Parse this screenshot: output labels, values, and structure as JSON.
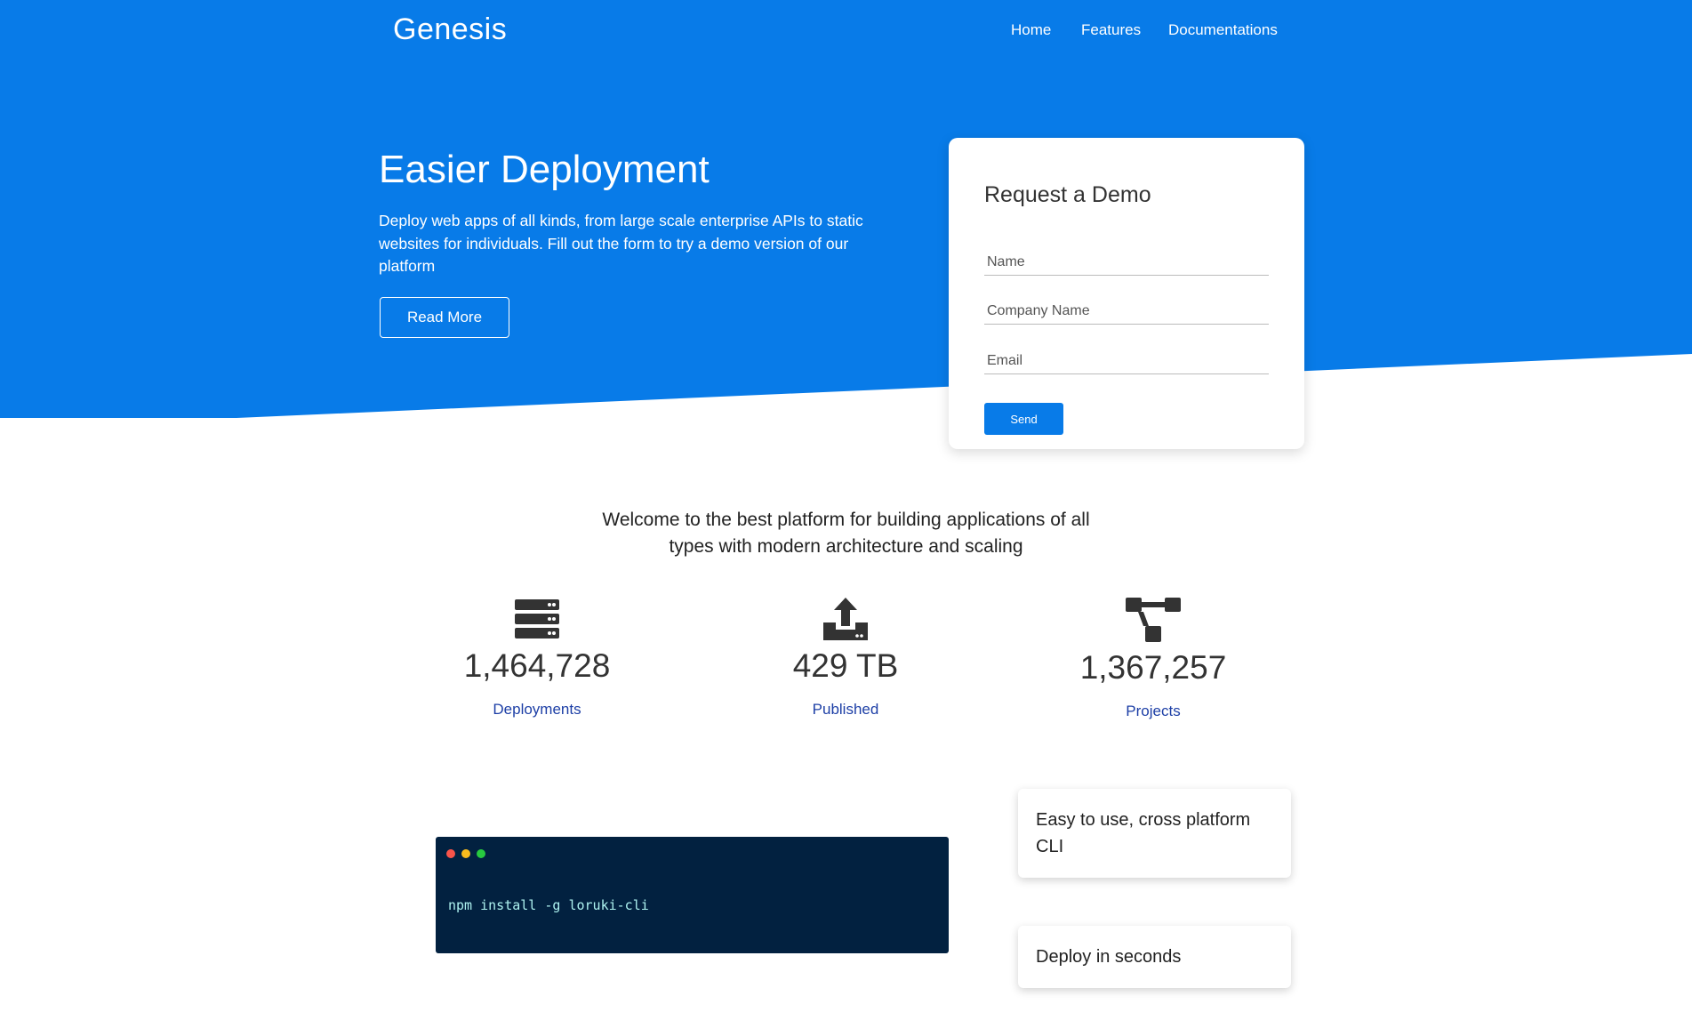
{
  "nav": {
    "logo": "Genesis",
    "links": [
      "Home",
      "Features",
      "Documentations"
    ]
  },
  "hero": {
    "title": "Easier Deployment",
    "description": "Deploy web apps of all kinds, from large scale enterprise APIs to static websites for individuals. Fill out the form to try a demo version of our platform",
    "button": "Read More"
  },
  "form": {
    "title": "Request a Demo",
    "name_placeholder": "Name",
    "company_placeholder": "Company Name",
    "email_placeholder": "Email",
    "send": "Send"
  },
  "welcome": "Welcome to the best platform for building applications of all types with modern architecture and scaling",
  "stats": [
    {
      "icon": "server-icon",
      "value": "1,464,728",
      "label": "Deployments"
    },
    {
      "icon": "upload-icon",
      "value": "429 TB",
      "label": "Published"
    },
    {
      "icon": "project-diagram-icon",
      "value": "1,367,257",
      "label": "Projects"
    }
  ],
  "terminal": {
    "command": "npm install -g loruki-cli"
  },
  "features": [
    "Easy to use, cross platform CLI",
    "Deploy in seconds"
  ],
  "colors": {
    "primary": "#087be8",
    "terminal": "#022140",
    "label": "#1d3fa6"
  }
}
